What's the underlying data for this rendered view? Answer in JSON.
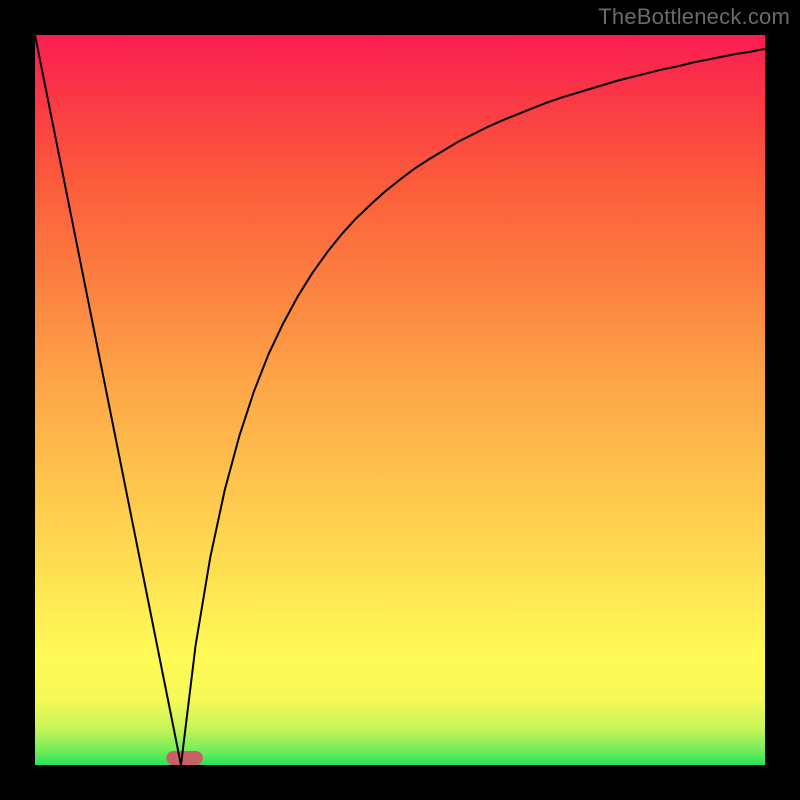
{
  "watermark": "TheBottleneck.com",
  "chart_data": {
    "type": "line",
    "x": [
      0.0,
      0.02,
      0.04,
      0.06,
      0.08,
      0.1,
      0.12,
      0.14,
      0.16,
      0.18,
      0.2,
      0.22,
      0.24,
      0.26,
      0.28,
      0.3,
      0.32,
      0.34,
      0.36,
      0.38,
      0.4,
      0.42,
      0.44,
      0.46,
      0.48,
      0.5,
      0.52,
      0.54,
      0.56,
      0.58,
      0.6,
      0.62,
      0.64,
      0.66,
      0.68,
      0.7,
      0.72,
      0.74,
      0.76,
      0.78,
      0.8,
      0.82,
      0.84,
      0.86,
      0.88,
      0.9,
      0.92,
      0.94,
      0.96,
      0.98,
      1.0
    ],
    "y": [
      1.0,
      0.9,
      0.8,
      0.7,
      0.6,
      0.5,
      0.4,
      0.3,
      0.2,
      0.1,
      0.0,
      0.164,
      0.284,
      0.377,
      0.451,
      0.512,
      0.563,
      0.605,
      0.642,
      0.674,
      0.702,
      0.727,
      0.749,
      0.768,
      0.786,
      0.802,
      0.817,
      0.83,
      0.842,
      0.854,
      0.864,
      0.874,
      0.883,
      0.891,
      0.899,
      0.907,
      0.914,
      0.92,
      0.926,
      0.932,
      0.938,
      0.943,
      0.948,
      0.953,
      0.957,
      0.962,
      0.966,
      0.97,
      0.974,
      0.977,
      0.981
    ],
    "title": "",
    "xlabel": "",
    "ylabel": "",
    "xlim": [
      0,
      1
    ],
    "ylim": [
      0,
      1
    ],
    "gradient_stops": [
      {
        "offset": 0.0,
        "color": "#26e35c"
      },
      {
        "offset": 0.02,
        "color": "#75ec5a"
      },
      {
        "offset": 0.05,
        "color": "#c5f558"
      },
      {
        "offset": 0.09,
        "color": "#f6f956"
      },
      {
        "offset": 0.15,
        "color": "#fffa56"
      },
      {
        "offset": 0.5,
        "color": "#fdab48"
      },
      {
        "offset": 0.8,
        "color": "#fb5b3a"
      },
      {
        "offset": 1.0,
        "color": "#fa1d4f"
      }
    ],
    "marker": {
      "x": 0.205,
      "width": 0.05,
      "color": "#c86065"
    }
  }
}
